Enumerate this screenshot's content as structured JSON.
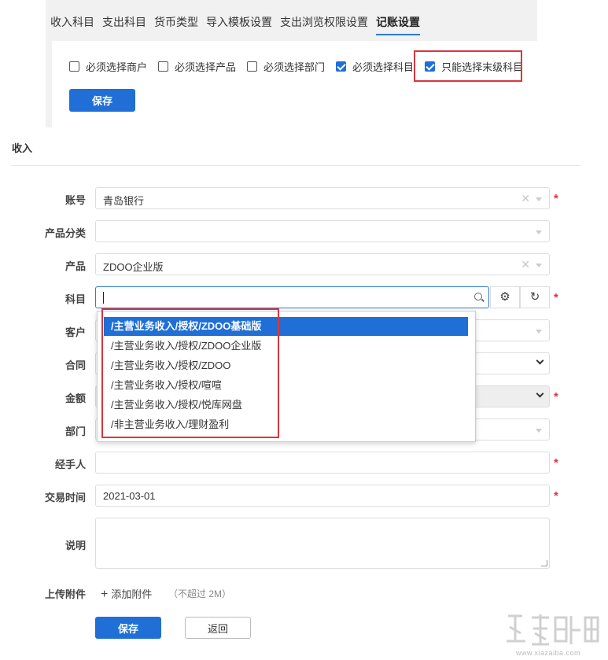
{
  "tabs": [
    {
      "label": "收入科目",
      "active": false
    },
    {
      "label": "支出科目",
      "active": false
    },
    {
      "label": "货币类型",
      "active": false
    },
    {
      "label": "导入模板设置",
      "active": false
    },
    {
      "label": "支出浏览权限设置",
      "active": false
    },
    {
      "label": "记账设置",
      "active": true
    }
  ],
  "settings": {
    "checkboxes": [
      {
        "label": "必须选择商户",
        "checked": false
      },
      {
        "label": "必须选择产品",
        "checked": false
      },
      {
        "label": "必须选择部门",
        "checked": false
      },
      {
        "label": "必须选择科目",
        "checked": true
      },
      {
        "label": "只能选择末级科目",
        "checked": true
      }
    ],
    "save_label": "保存"
  },
  "form": {
    "section_title": "收入",
    "account_label": "账号",
    "account_value": "青岛银行",
    "category_label": "产品分类",
    "category_value": "",
    "product_label": "产品",
    "product_value": "ZDOO企业版",
    "subject_label": "科目",
    "subject_value": "",
    "customer_label": "客户",
    "contract_label": "合同",
    "amount_label": "金额",
    "dept_label": "部门",
    "handler_label": "经手人",
    "handler_value": "",
    "time_label": "交易时间",
    "time_value": "2021-03-01",
    "note_label": "说明",
    "note_value": "",
    "upload_label": "上传附件",
    "add_attachment": "添加附件",
    "size_hint": "（不超过 2M）",
    "save_label": "保存",
    "back_label": "返回",
    "required_mark": "*"
  },
  "subject_options": [
    {
      "label": "/主营业务收入/授权/ZDOO基础版",
      "selected": true
    },
    {
      "label": "/主营业务收入/授权/ZDOO企业版",
      "selected": false
    },
    {
      "label": "/主营业务收入/授权/ZDOO",
      "selected": false
    },
    {
      "label": "/主营业务收入/授权/喧喧",
      "selected": false
    },
    {
      "label": "/主营业务收入/授权/悦库网盘",
      "selected": false
    },
    {
      "label": "/非主营业务收入/理财盈利",
      "selected": false
    }
  ],
  "icons": {
    "settings": "gear-icon",
    "refresh": "refresh-icon",
    "search": "search-icon",
    "clear": "clear-icon",
    "add": "plus-icon"
  },
  "colors": {
    "primary": "#1f6fd6",
    "required": "#d9363e",
    "highlight_box": "#d9363e"
  },
  "watermark": {
    "site": "www.xiazaiba.com"
  }
}
